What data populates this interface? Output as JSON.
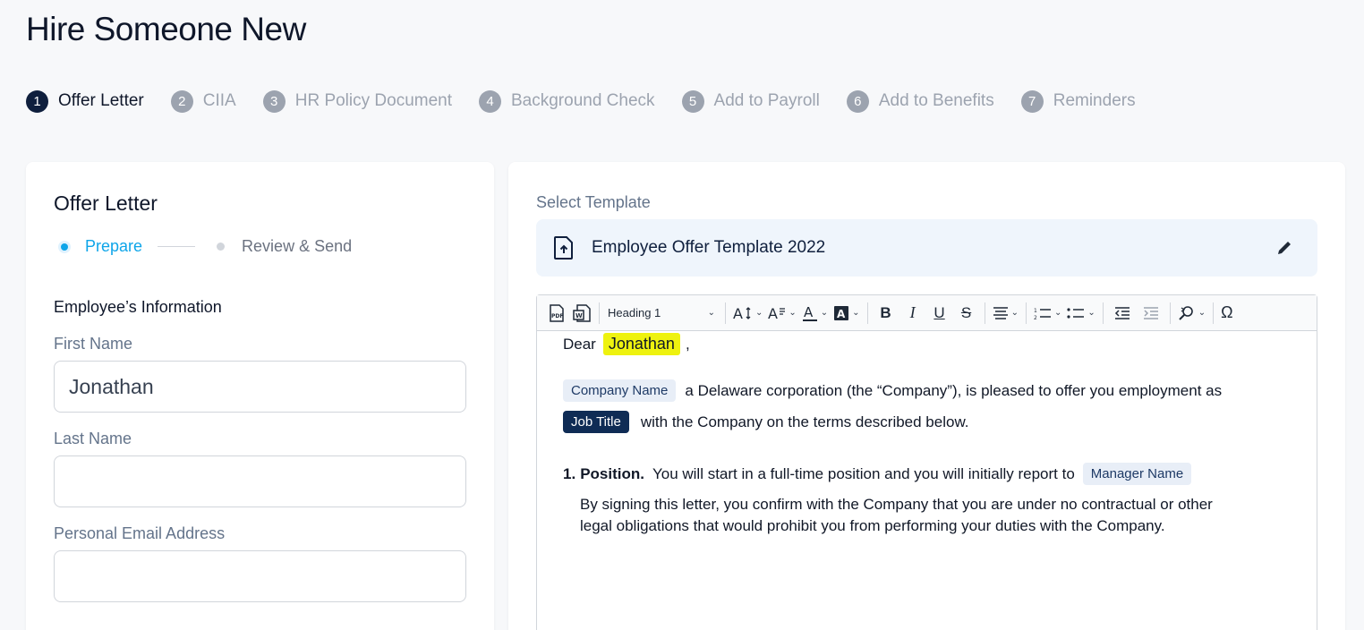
{
  "page": {
    "title": "Hire Someone New"
  },
  "stepper": [
    {
      "num": "1",
      "label": "Offer Letter",
      "active": true
    },
    {
      "num": "2",
      "label": "CIIA"
    },
    {
      "num": "3",
      "label": "HR Policy Document"
    },
    {
      "num": "4",
      "label": "Background Check"
    },
    {
      "num": "5",
      "label": "Add to Payroll"
    },
    {
      "num": "6",
      "label": "Add to Benefits"
    },
    {
      "num": "7",
      "label": "Reminders"
    }
  ],
  "left": {
    "title": "Offer Letter",
    "substeps": {
      "active": "Prepare",
      "next": "Review & Send"
    },
    "section": "Employee’s Information",
    "fields": {
      "first_name": {
        "label": "First Name",
        "value": "Jonathan"
      },
      "last_name": {
        "label": "Last Name",
        "value": ""
      },
      "email": {
        "label": "Personal Email Address",
        "value": ""
      }
    }
  },
  "right": {
    "template_label": "Select Template",
    "template_name": "Employee Offer Template 2022",
    "toolbar": {
      "heading": "Heading 1"
    },
    "doc": {
      "greeting": "Dear",
      "name_token": "Jonathan",
      "comma": ",",
      "company_token": "Company Name",
      "line1_text": "a Delaware corporation (the “Company”), is pleased to offer you employment as",
      "job_token": "Job Title",
      "line2_text": "with the Company on the terms described below.",
      "item_num": "1.",
      "item_title": "Position.",
      "item_text": "You will start in a full-time position and you will initially report to",
      "manager_token": "Manager Name",
      "para_line1": "By signing this letter, you confirm with the Company that you are under no contractual or other",
      "para_line2": "legal obligations that would prohibit you from performing your duties with the Company."
    }
  },
  "colors": {
    "accent": "#0ea5e9",
    "navy": "#0f1f3d",
    "highlight": "#eef20f"
  }
}
